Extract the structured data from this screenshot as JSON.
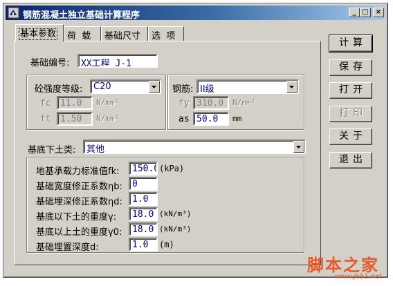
{
  "window": {
    "title": "钢筋混凝土独立基础计算程序",
    "minimize": "_",
    "maximize": "□",
    "close": "×"
  },
  "tabs": [
    "基本参数",
    "荷  载",
    "基础尺寸",
    "选  项"
  ],
  "basic": {
    "foundation_no_label": "基础编号:",
    "foundation_no_value": "XX工程 J-1",
    "concrete_grade_label": "砼强度等级:",
    "concrete_grade_value": "C20",
    "fc_label": "fc",
    "fc_value": "11.0",
    "fc_unit": "N/mm²",
    "ft_label": "ft",
    "ft_value": "1.50",
    "ft_unit": "N/mm²",
    "rebar_label": "钢筋:",
    "rebar_value": "II级",
    "fy_label": "fy",
    "fy_value": "310.0",
    "fy_unit": "N/mm²",
    "as_label": "as",
    "as_value": "50.0",
    "as_unit": "mm",
    "soil_label": "基底下土类:",
    "soil_value": "其他",
    "fk_label": "地基承载力标准值fk:",
    "fk_value": "150.0",
    "fk_unit": "(kPa)",
    "eta_b_label": "基础宽度修正系数ηb:",
    "eta_b_value": "0",
    "eta_d_label": "基础埋深修正系数ηd:",
    "eta_d_value": "1.0",
    "gamma_label": "基底以下土的重度γ:",
    "gamma_value": "18.0",
    "gamma_unit": "(kN/m³)",
    "gamma0_label": "基底以上土的重度γ0:",
    "gamma0_value": "18.0",
    "gamma0_unit": "(kN/m³)",
    "depth_label": "基础埋置深度d:",
    "depth_value": "1.0",
    "depth_unit": "(m)"
  },
  "buttons": {
    "calc": "计算",
    "save": "保存",
    "open": "打开",
    "print": "打印",
    "about": "关于",
    "exit": "退出"
  },
  "watermark": {
    "main": "脚本之家",
    "sub": "www.jb51.net"
  },
  "colors": {
    "title_start": "#0a246a",
    "title_end": "#a6caf0",
    "face": "#d4d0c8",
    "input_text": "#000080",
    "watermark": "#e35b2c"
  }
}
